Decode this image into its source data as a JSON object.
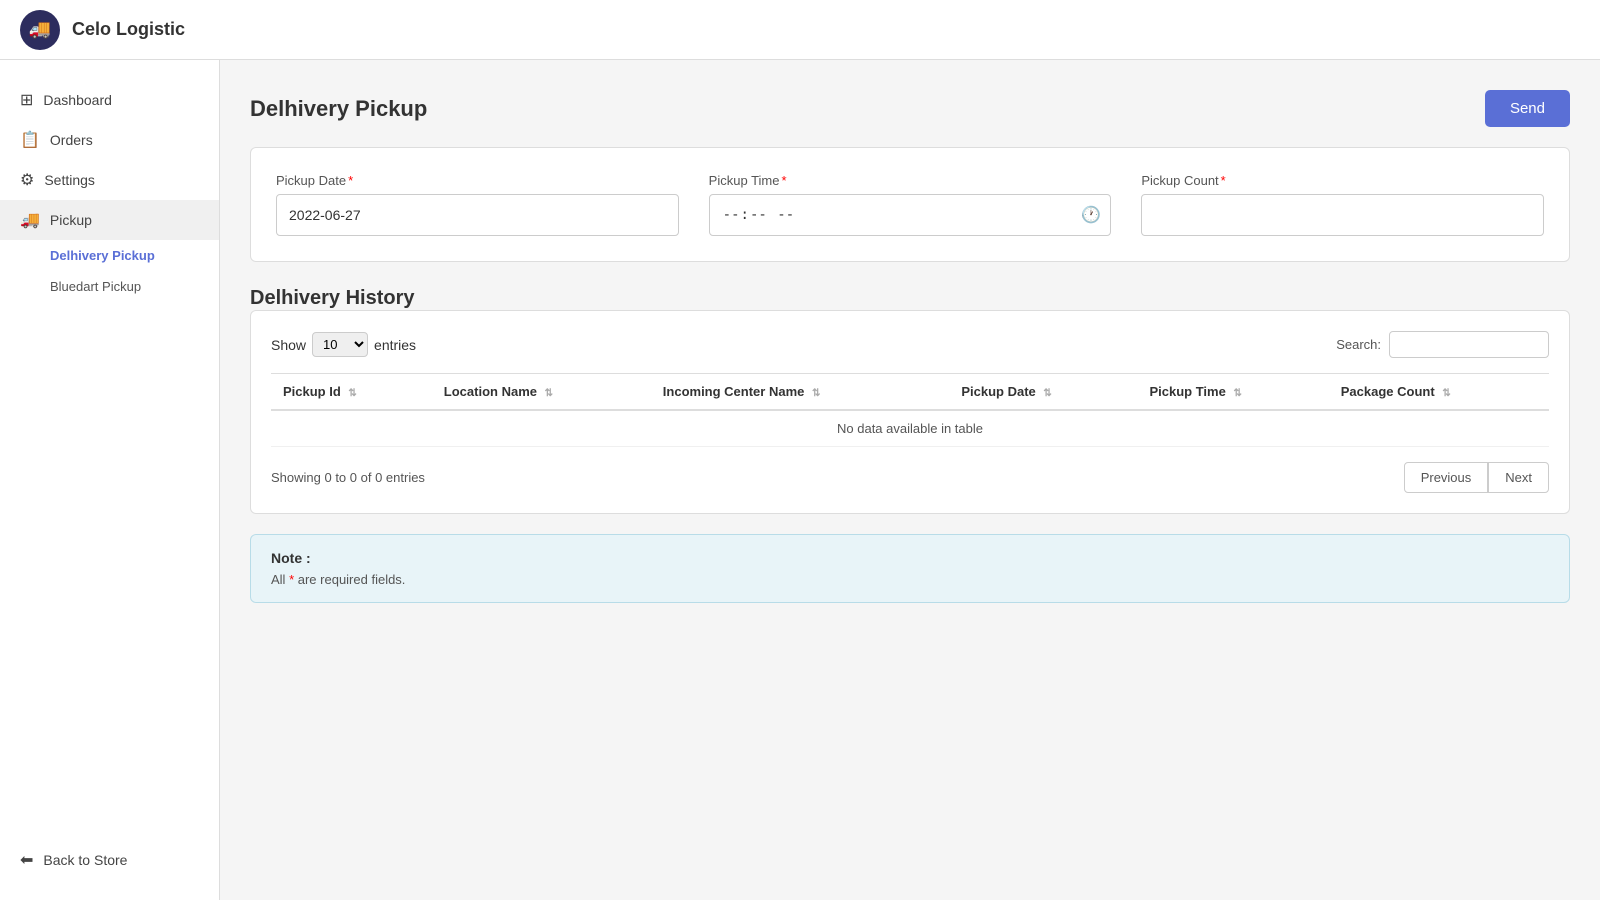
{
  "app": {
    "logo_icon": "🚚",
    "title": "Celo Logistic"
  },
  "sidebar": {
    "items": [
      {
        "id": "dashboard",
        "label": "Dashboard",
        "icon": "⊞",
        "active": false
      },
      {
        "id": "orders",
        "label": "Orders",
        "icon": "📋",
        "active": false
      },
      {
        "id": "settings",
        "label": "Settings",
        "icon": "⚙",
        "active": false
      },
      {
        "id": "pickup",
        "label": "Pickup",
        "icon": "🚚",
        "active": true
      }
    ],
    "subitems": [
      {
        "id": "delhivery-pickup",
        "label": "Delhivery Pickup",
        "active": true
      },
      {
        "id": "bluedart-pickup",
        "label": "Bluedart Pickup",
        "active": false
      }
    ],
    "bottom_label": "Back to Store",
    "bottom_icon": "←"
  },
  "page": {
    "title": "Delhivery Pickup",
    "send_button": "Send"
  },
  "form": {
    "pickup_date_label": "Pickup Date",
    "pickup_date_value": "2022-06-27",
    "pickup_time_label": "Pickup Time",
    "pickup_time_placeholder": "--:--",
    "pickup_count_label": "Pickup Count"
  },
  "history": {
    "title": "Delhivery History",
    "show_label": "Show",
    "show_value": "10",
    "entries_label": "entries",
    "search_label": "Search:",
    "search_placeholder": "",
    "columns": [
      {
        "id": "pickup-id",
        "label": "Pickup Id"
      },
      {
        "id": "location-name",
        "label": "Location Name"
      },
      {
        "id": "incoming-center-name",
        "label": "Incoming Center Name"
      },
      {
        "id": "pickup-date",
        "label": "Pickup Date"
      },
      {
        "id": "pickup-time",
        "label": "Pickup Time"
      },
      {
        "id": "package-count",
        "label": "Package Count"
      }
    ],
    "no_data_message": "No data available in table",
    "showing_text": "Showing 0 to 0 of 0 entries",
    "prev_button": "Previous",
    "next_button": "Next"
  },
  "note": {
    "title": "Note :",
    "text": " are required fields.",
    "prefix": "All"
  }
}
